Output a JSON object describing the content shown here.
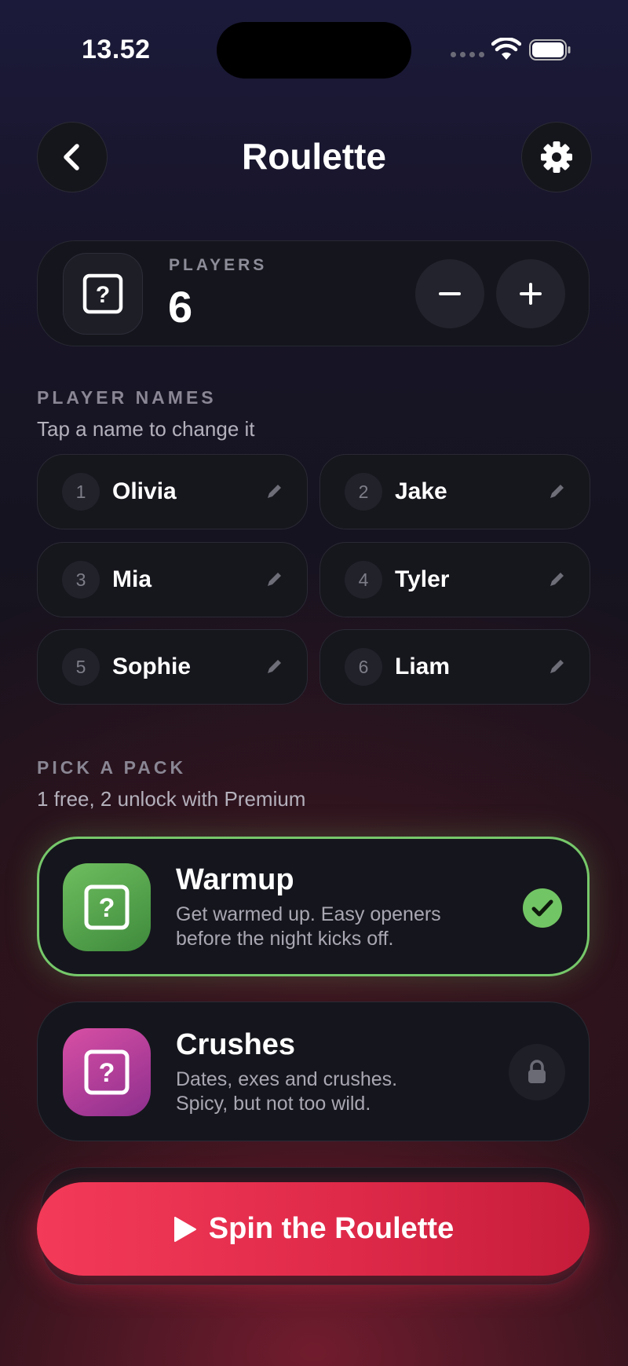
{
  "status_bar": {
    "time": "13.52"
  },
  "header": {
    "title": "Roulette"
  },
  "players": {
    "label": "PLAYERS",
    "count": "6"
  },
  "player_names": {
    "heading": "PLAYER NAMES",
    "subtitle": "Tap a name to change it",
    "items": [
      {
        "number": "1",
        "name": "Olivia"
      },
      {
        "number": "2",
        "name": "Jake"
      },
      {
        "number": "3",
        "name": "Mia"
      },
      {
        "number": "4",
        "name": "Tyler"
      },
      {
        "number": "5",
        "name": "Sophie"
      },
      {
        "number": "6",
        "name": "Liam"
      }
    ]
  },
  "packs": {
    "heading": "PICK A PACK",
    "subtitle": "1 free, 2 unlock with Premium",
    "items": [
      {
        "title": "Warmup",
        "desc_line1": "Get warmed up. Easy openers",
        "desc_line2": "before the night kicks off.",
        "state": "selected",
        "color": "#72c564"
      },
      {
        "title": "Crushes",
        "desc_line1": "Dates, exes and crushes.",
        "desc_line2": "Spicy, but not too wild.",
        "state": "locked",
        "color": "#c845a0"
      }
    ]
  },
  "spin_button": {
    "label": "Spin the Roulette"
  },
  "icons": [
    "chevron-left-icon",
    "gear-icon",
    "question-mark-icon",
    "minus-icon",
    "plus-icon",
    "pencil-icon",
    "checkmark-icon",
    "lock-icon",
    "play-icon",
    "wifi-icon",
    "battery-icon",
    "signal-icon"
  ],
  "colors": {
    "accent_red": "#e8304f",
    "selected_green": "#72c564",
    "pink": "#c845a0"
  }
}
